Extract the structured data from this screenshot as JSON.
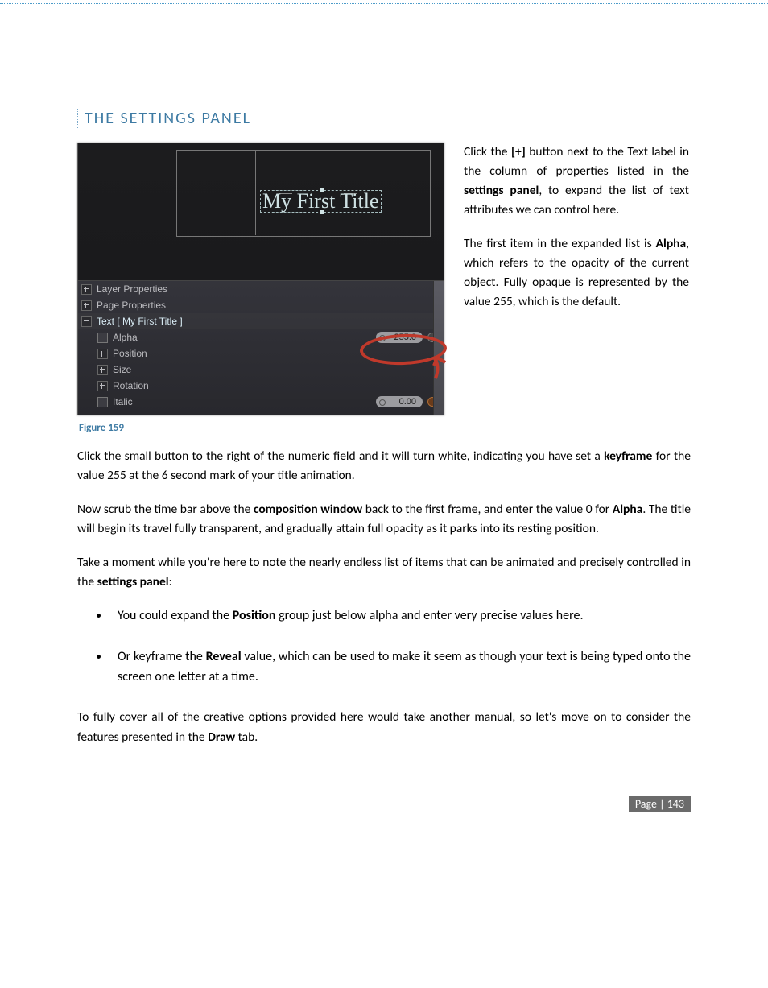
{
  "heading": "THE SETTINGS PANEL",
  "screenshot": {
    "composition_text": "My First Title",
    "panel": {
      "layer_properties": "Layer Properties",
      "page_properties": "Page Properties",
      "text_item": "Text [ My First Title ]",
      "alpha": "Alpha",
      "alpha_value": "255.0",
      "position": "Position",
      "size": "Size",
      "rotation": "Rotation",
      "italic": "Italic",
      "italic_value": "0.00"
    }
  },
  "figure_caption": "Figure 159",
  "aside": {
    "p1_a": "Click the ",
    "p1_bold1": "[+]",
    "p1_b": " button next to the Text label in the column of properties listed in the ",
    "p1_bold2": "settings panel",
    "p1_c": ", to expand the list of text attributes we can control here.",
    "p2_a": "The first item in the expanded list is ",
    "p2_bold": "Alpha",
    "p2_b": ", which refers to the opacity of the current object.  Fully opaque is represented by the value 255, which is the default."
  },
  "para1_a": "Click the small button to the right of the numeric field and it will turn white, indicating you have set a ",
  "para1_bold": "keyframe",
  "para1_b": " for the value 255 at the 6 second mark of your title animation.",
  "para2_a": "Now scrub the time bar above the ",
  "para2_bold1": "composition window",
  "para2_b": " back to the first frame, and enter the value 0 for ",
  "para2_bold2": "Alpha",
  "para2_c": ".  The title will begin its travel fully transparent, and gradually attain full opacity as it parks into its resting position.",
  "para3_a": "Take a moment while you're here to note the nearly endless list of items that can be animated and precisely controlled in the ",
  "para3_bold": "settings panel",
  "para3_b": ":",
  "bullet1_a": "You could expand the ",
  "bullet1_bold": "Position",
  "bullet1_b": " group just below alpha and enter very precise values here.",
  "bullet2_a": "Or keyframe the ",
  "bullet2_bold": "Reveal",
  "bullet2_b": " value, which can be used to make it seem as though your text is being typed onto the screen one letter at a time.",
  "para4_a": "To fully cover all of the creative options provided here would take another manual, so let's move on to consider the features presented in the ",
  "para4_bold": "Draw",
  "para4_b": " tab.",
  "footer_label": "Page | ",
  "footer_no": "143"
}
